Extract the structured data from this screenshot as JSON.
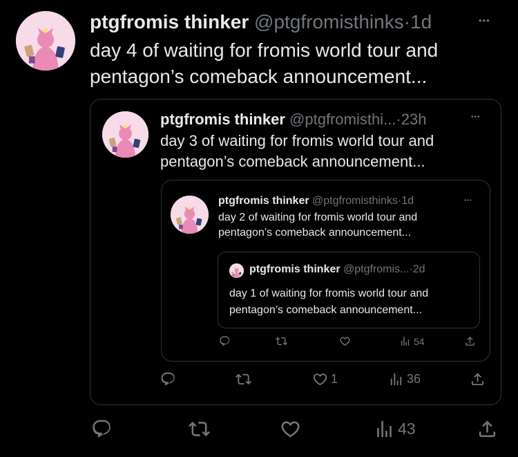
{
  "post": {
    "display_name": "ptgfromis thinker",
    "handle": "@ptgfromisthinks",
    "time": "1d",
    "text_line1": "day 4 of waiting for fromis world tour and",
    "text_line2": "pentagon’s comeback announcement...",
    "more": "•••",
    "stats": {
      "views": "43"
    }
  },
  "quote1": {
    "display_name": "ptgfromis thinker",
    "handle": "@ptgfromisthi...",
    "time": "23h",
    "text_line1": "day 3 of waiting for fromis world tour and",
    "text_line2": "pentagon’s comeback announcement...",
    "more": "•••",
    "stats": {
      "likes": "1",
      "views": "36"
    }
  },
  "quote2": {
    "display_name": "ptgfromis thinker",
    "handle": "@ptgfromisthinks",
    "time": "1d",
    "text_line1": "day 2 of waiting for fromis world tour and",
    "text_line2": "pentagon’s comeback announcement...",
    "more": "•••",
    "stats": {
      "views": "54"
    }
  },
  "quote3": {
    "display_name": "ptgfromis thinker",
    "handle": "@ptgfromis...",
    "time": "2d",
    "text_line1": "day 1 of waiting for fromis world tour and",
    "text_line2": "pentagon’s comeback announcement..."
  },
  "icons": {
    "reply": "reply-icon",
    "retweet": "retweet-icon",
    "like": "heart-icon",
    "views": "views-icon",
    "share": "share-icon",
    "more": "more-icon"
  },
  "colors": {
    "background": "#000000",
    "text": "#e7e9ea",
    "muted": "#71767b",
    "border": "#2f3336",
    "avatar_bg": "#f7dbe8"
  }
}
